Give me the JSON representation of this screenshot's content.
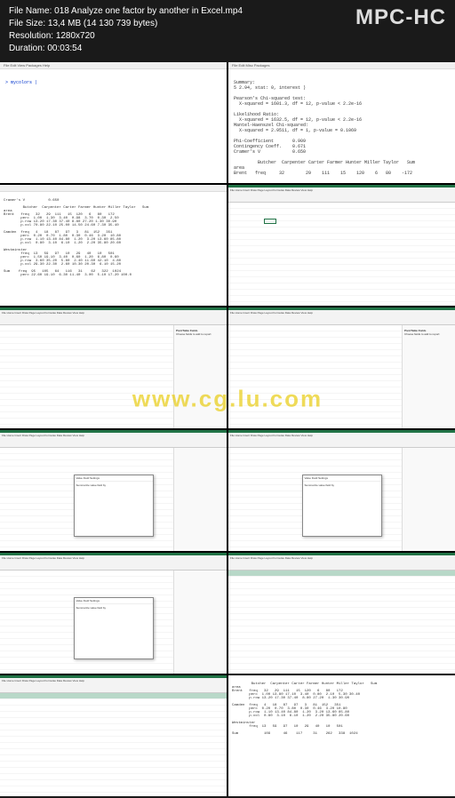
{
  "header": {
    "file_name_label": "File Name:",
    "file_name": "018 Analyze one factor by another in Excel.mp4",
    "file_size_label": "File Size:",
    "file_size": "13,4 MB (14 130 739 bytes)",
    "resolution_label": "Resolution:",
    "resolution": "1280x720",
    "duration_label": "Duration:",
    "duration": "00:03:54",
    "brand": "MPC-HC"
  },
  "watermark": "www.cg.lu.com",
  "thumbs": {
    "r_script": "> mycolors |",
    "r_output_1": "Summary:\n5 2.94, stat: 0, interest )\n\nPearson's Chi-squared test:\n  X-squared = 1601.3, df = 12, p-value < 2.2e-16\n\nLikelihood Ratio:\n  X-squared = 1632.5, df = 12, p-value < 2.2e-16\nMantel-Haenszel Chi-squared:\n  X-squared = 2.9511, df = 1, p-value = 0.1069\n\nPhi-Coefficient       0.909\nContingency Coeff.    0.671\nCramer's V            0.650\n\n         Butcher  Carpenter Carter Farmer Hunter Miller Taylor   Sum\narea\nBrent   freq     32        29    111    15    120    6   80    -172",
    "stats_table": "Cramer's V           0.650\n\n         Butcher  Carpenter Carter Farmer Hunter Miller Taylor   Sum\narea\nBrent   freq   32   29  111   15  120   6   80   172\n        perc  1.00  1.30  3.40  0.98  3.70  0.30  2.50\n        p.row 13.20 17.30 37.40 8.80 27.20 1.30 30.90\n        p.col 70.80 22.10 25.00 14.50 24.60 7.30 35.40\n\nCamden  freq   4   18   87   97   3   81  152   351\n        perc  0.20  0.70  1.80  0.30  0.46  3.20  10.80\n        p.row  1.10 13.40 84.80  1.20  3.20 13.60 85.80\n        p.col  0.80  3.10  6.10  1.20  2.20 35.80 20.60\n\nWestminster\n        freq  13   59   97   10   29   40   10   501\n        perc  1.50 19.10  3.40  0.60  1.20  6.80  0.60\n        p.row  3.60 35.20  5.80  2.40 11.60 42.10  4.80\n        p.col 29.30 22.30  2.60 10.30 20.30  6.10 15.20\n\nSum    freq  95   105   64   116   31    62   322  1024\n        perc 22.60 19.10  6.30 11.40  3.00  5.10 17.20 100.0",
    "excel_ribbon": "File Home Insert Draw Page Layout Formulas Data Review View Help",
    "pivot_panel_title": "PivotTable Fields",
    "pivot_panel_hint": "Choose fields to add to report:",
    "dialog_title": "Value Field Settings",
    "dialog_summarize": "Summarize value field by",
    "last_stats": "         Butcher  Carpenter Carter Farmer Hunter Miller Taylor   Sum\narea\nBrent   freq   32   29  111   15  120   6   80   172\n        perc  1.00 13.80 17.10  3.40  0.80  2.10  5.30 30.40\n        p.row 13.20 17.30 37.40  8.80 27.20  1.30 30.90\n\nCamden  freq   4   18   87   97   3   81  152   351\n        perc  0.20  0.70  3.80  0.30  0.46  3.20 10.80\n        p.row  1.10 13.40 84.80  1.20  3.20 13.60 85.80\n        p.col  0.80  3.10  6.10  1.20  2.20 35.80 20.60\n\nWestminster\n        freq  13   59   97   10   29   40   10   501\n\nSum            109      46    117     31    262   338  1024"
  }
}
